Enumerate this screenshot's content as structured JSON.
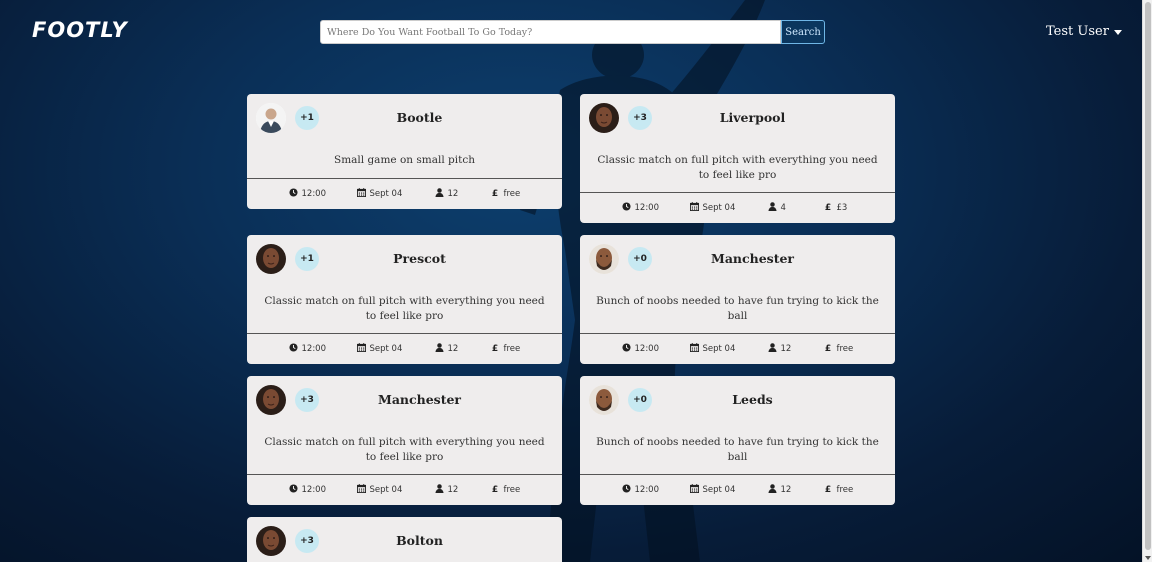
{
  "navbar": {
    "logo": "FOOTLY",
    "search_placeholder": "Where Do You Want Football To Go Today?",
    "search_button": "Search",
    "user_name": "Test User"
  },
  "icons": {
    "time": "clock-icon",
    "date": "calendar-icon",
    "players": "user-icon",
    "price": "pound-icon",
    "menu": "caret-down-icon"
  },
  "colors": {
    "card_bg": "#efeded",
    "badge_bg": "#c7e9f2",
    "page_bg": "#0a2f57"
  },
  "cards": [
    {
      "title": "Bootle",
      "badge": "+1",
      "desc": "Small game on small pitch",
      "time": "12:00",
      "date": "Sept 04",
      "players": "12",
      "price": "free",
      "avatar": "light"
    },
    {
      "title": "Liverpool",
      "badge": "+3",
      "desc": "Classic match on full pitch with everything you need to feel like pro",
      "time": "12:00",
      "date": "Sept 04",
      "players": "4",
      "price": "£3",
      "avatar": "dark"
    },
    {
      "title": "Prescot",
      "badge": "+1",
      "desc": "Classic match on full pitch with everything you need to feel like pro",
      "time": "12:00",
      "date": "Sept 04",
      "players": "12",
      "price": "free",
      "avatar": "dark"
    },
    {
      "title": "Manchester",
      "badge": "+0",
      "desc": "Bunch of noobs needed to have fun trying to kick the ball",
      "time": "12:00",
      "date": "Sept 04",
      "players": "12",
      "price": "free",
      "avatar": "beard"
    },
    {
      "title": "Manchester",
      "badge": "+3",
      "desc": "Classic match on full pitch with everything you need to feel like pro",
      "time": "12:00",
      "date": "Sept 04",
      "players": "12",
      "price": "free",
      "avatar": "dark"
    },
    {
      "title": "Leeds",
      "badge": "+0",
      "desc": "Bunch of noobs needed to have fun trying to kick the ball",
      "time": "12:00",
      "date": "Sept 04",
      "players": "12",
      "price": "free",
      "avatar": "beard"
    },
    {
      "title": "Bolton",
      "badge": "+3",
      "desc": "",
      "time": "",
      "date": "",
      "players": "",
      "price": "",
      "avatar": "dark"
    }
  ]
}
